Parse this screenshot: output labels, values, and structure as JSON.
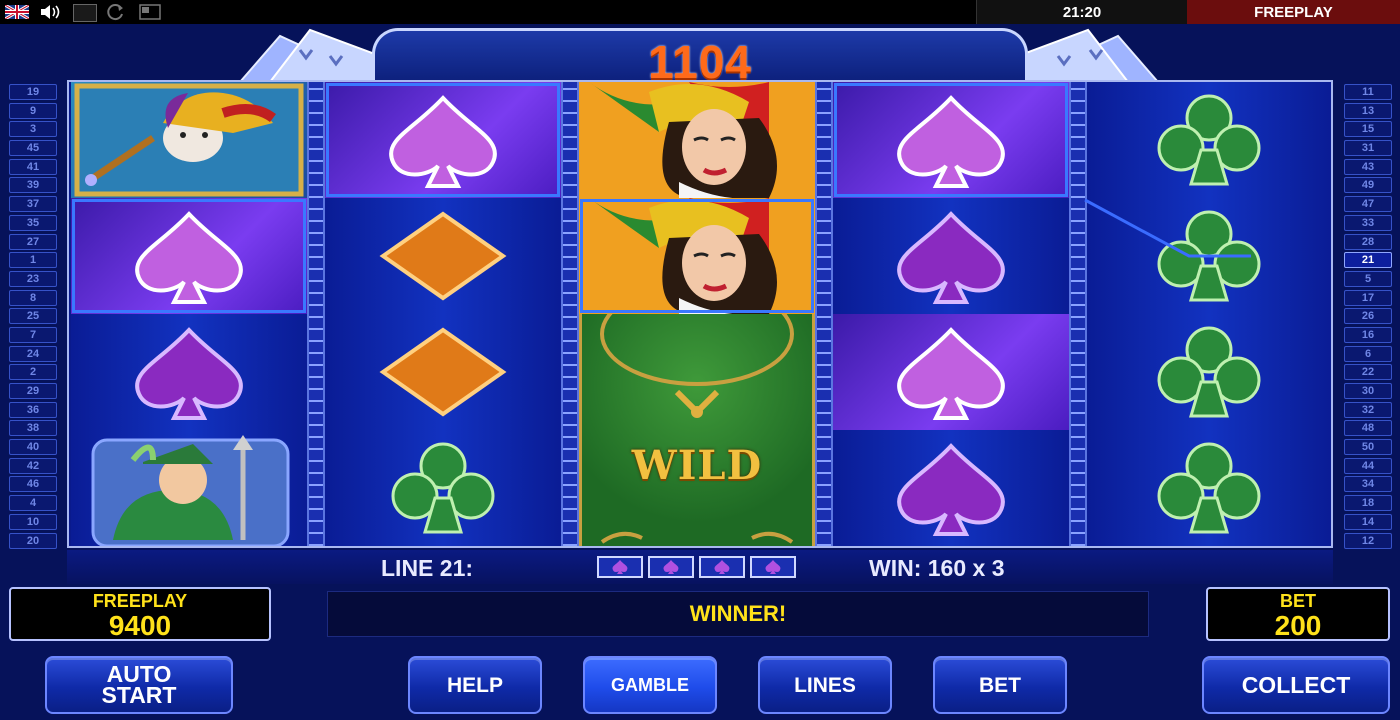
{
  "topbar": {
    "clock": "21:20",
    "mode": "FREEPLAY",
    "icons": [
      "uk-flag-icon",
      "speaker-icon",
      "blank-icon",
      "refresh-icon",
      "window-icon"
    ]
  },
  "header": {
    "counter": "1104"
  },
  "side_lines": {
    "left": [
      "19",
      "9",
      "3",
      "45",
      "41",
      "39",
      "37",
      "35",
      "27",
      "1",
      "23",
      "8",
      "25",
      "7",
      "24",
      "2",
      "29",
      "36",
      "38",
      "40",
      "42",
      "46",
      "4",
      "10",
      "20"
    ],
    "right": [
      "11",
      "13",
      "15",
      "31",
      "43",
      "49",
      "47",
      "33",
      "28",
      "21",
      "5",
      "17",
      "26",
      "16",
      "6",
      "22",
      "30",
      "32",
      "48",
      "50",
      "44",
      "34",
      "18",
      "14",
      "12"
    ],
    "active_right": "21"
  },
  "reels": {
    "wild_label": "WILD",
    "reel1": [
      "jester-hat-symbol",
      "purple-spade-symbol",
      "purple-spade-symbol",
      "jack-card-symbol"
    ],
    "reel2": [
      "purple-spade-symbol",
      "orange-diamond-symbol",
      "orange-diamond-symbol",
      "green-club-symbol"
    ],
    "reel3": [
      "queen-jester-symbol",
      "queen-jester-symbol",
      "wild-symbol",
      "wild-symbol"
    ],
    "reel4": [
      "purple-spade-symbol",
      "purple-spade-symbol",
      "purple-spade-symbol",
      "purple-spade-symbol"
    ],
    "reel5": [
      "green-club-symbol",
      "green-club-symbol",
      "green-club-symbol",
      "green-club-symbol"
    ]
  },
  "info": {
    "line_label": "LINE 21:",
    "win_label": "WIN: 160 x 3"
  },
  "meters": {
    "freeplay_label": "FREEPLAY",
    "freeplay_value": "9400",
    "bet_label": "BET",
    "bet_value": "200"
  },
  "status": "WINNER!",
  "buttons": {
    "auto_start": "AUTO\nSTART",
    "help": "HELP",
    "gamble": "GAMBLE",
    "lines": "LINES",
    "bet": "BET",
    "collect": "COLLECT"
  },
  "colors": {
    "counter": "#ff6a1a",
    "meter_text": "#ffe21a",
    "highlight": "#7a3cf0"
  }
}
